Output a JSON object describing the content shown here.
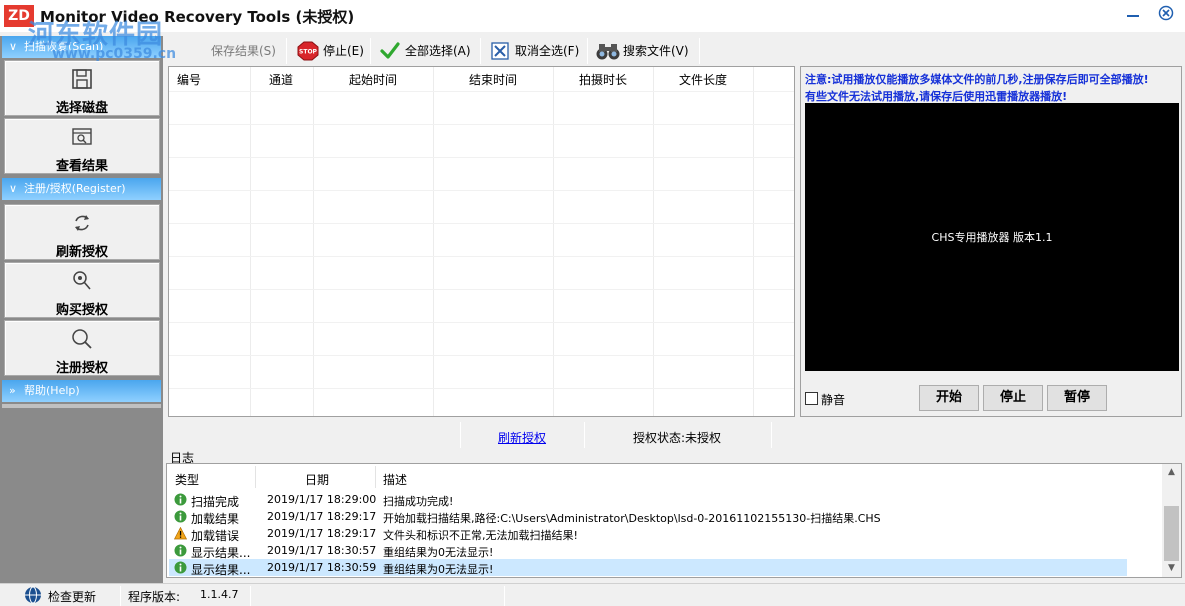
{
  "window": {
    "logo": "ZD",
    "title": "Monitor Video Recovery Tools (未授权)",
    "watermark": "河东软件园",
    "watermark_url": "www.pc0359.cn"
  },
  "sidebar": {
    "scan_section": "扫描恢复(Scan)",
    "scan_buttons": [
      "选择磁盘",
      "查看结果"
    ],
    "register_section": "注册/授权(Register)",
    "register_buttons": [
      "刷新授权",
      "购买授权",
      "注册授权"
    ],
    "help_section": "帮助(Help)"
  },
  "toolbar": {
    "save": "保存结果(S)",
    "stop": "停止(E)",
    "select_all": "全部选择(A)",
    "deselect_all": "取消全选(F)",
    "search_files": "搜索文件(V)"
  },
  "result_table": {
    "columns": [
      "编号",
      "通道",
      "起始时间",
      "结束时间",
      "拍摄时长",
      "文件长度"
    ],
    "rows": []
  },
  "player": {
    "notice_line1": "注意:试用播放仅能播放多媒体文件的前几秒,注册保存后即可全部播放!",
    "notice_line2": "有些文件无法试用播放,请保存后使用迅雷播放器播放!",
    "caption": "CHS专用播放器 版本1.1",
    "mute": "静音",
    "start": "开始",
    "stop": "停止",
    "pause": "暂停",
    "mute_checked": false
  },
  "auth_strip": {
    "refresh_link": "刷新授权",
    "status": "授权状态:未授权"
  },
  "log": {
    "title": "日志",
    "columns": [
      "类型",
      "日期",
      "描述"
    ],
    "rows": [
      {
        "level": "info",
        "type": "扫描完成",
        "date": "2019/1/17 18:29:00",
        "desc": "扫描成功完成!"
      },
      {
        "level": "info",
        "type": "加载结果",
        "date": "2019/1/17 18:29:17",
        "desc": "开始加载扫描结果,路径:C:\\Users\\Administrator\\Desktop\\lsd-0-20161102155130-扫描结果.CHS"
      },
      {
        "level": "warning",
        "type": "加载错误",
        "date": "2019/1/17 18:29:17",
        "desc": "文件头和标识不正常,无法加载扫描结果!"
      },
      {
        "level": "info",
        "type": "显示结果...",
        "date": "2019/1/17 18:30:57",
        "desc": "重组结果为0无法显示!"
      },
      {
        "level": "info",
        "type": "显示结果...",
        "date": "2019/1/17 18:30:59",
        "desc": "重组结果为0无法显示!",
        "selected": true
      }
    ]
  },
  "statusbar": {
    "check_update": "检查更新",
    "version_label": "程序版本:",
    "version": "1.1.4.7"
  },
  "colors": {
    "accent_blue": "#4aa6ee",
    "notice_blue": "#1631d8",
    "sidebar_bg": "#8a8a8a",
    "selected_row": "#cce8ff"
  }
}
